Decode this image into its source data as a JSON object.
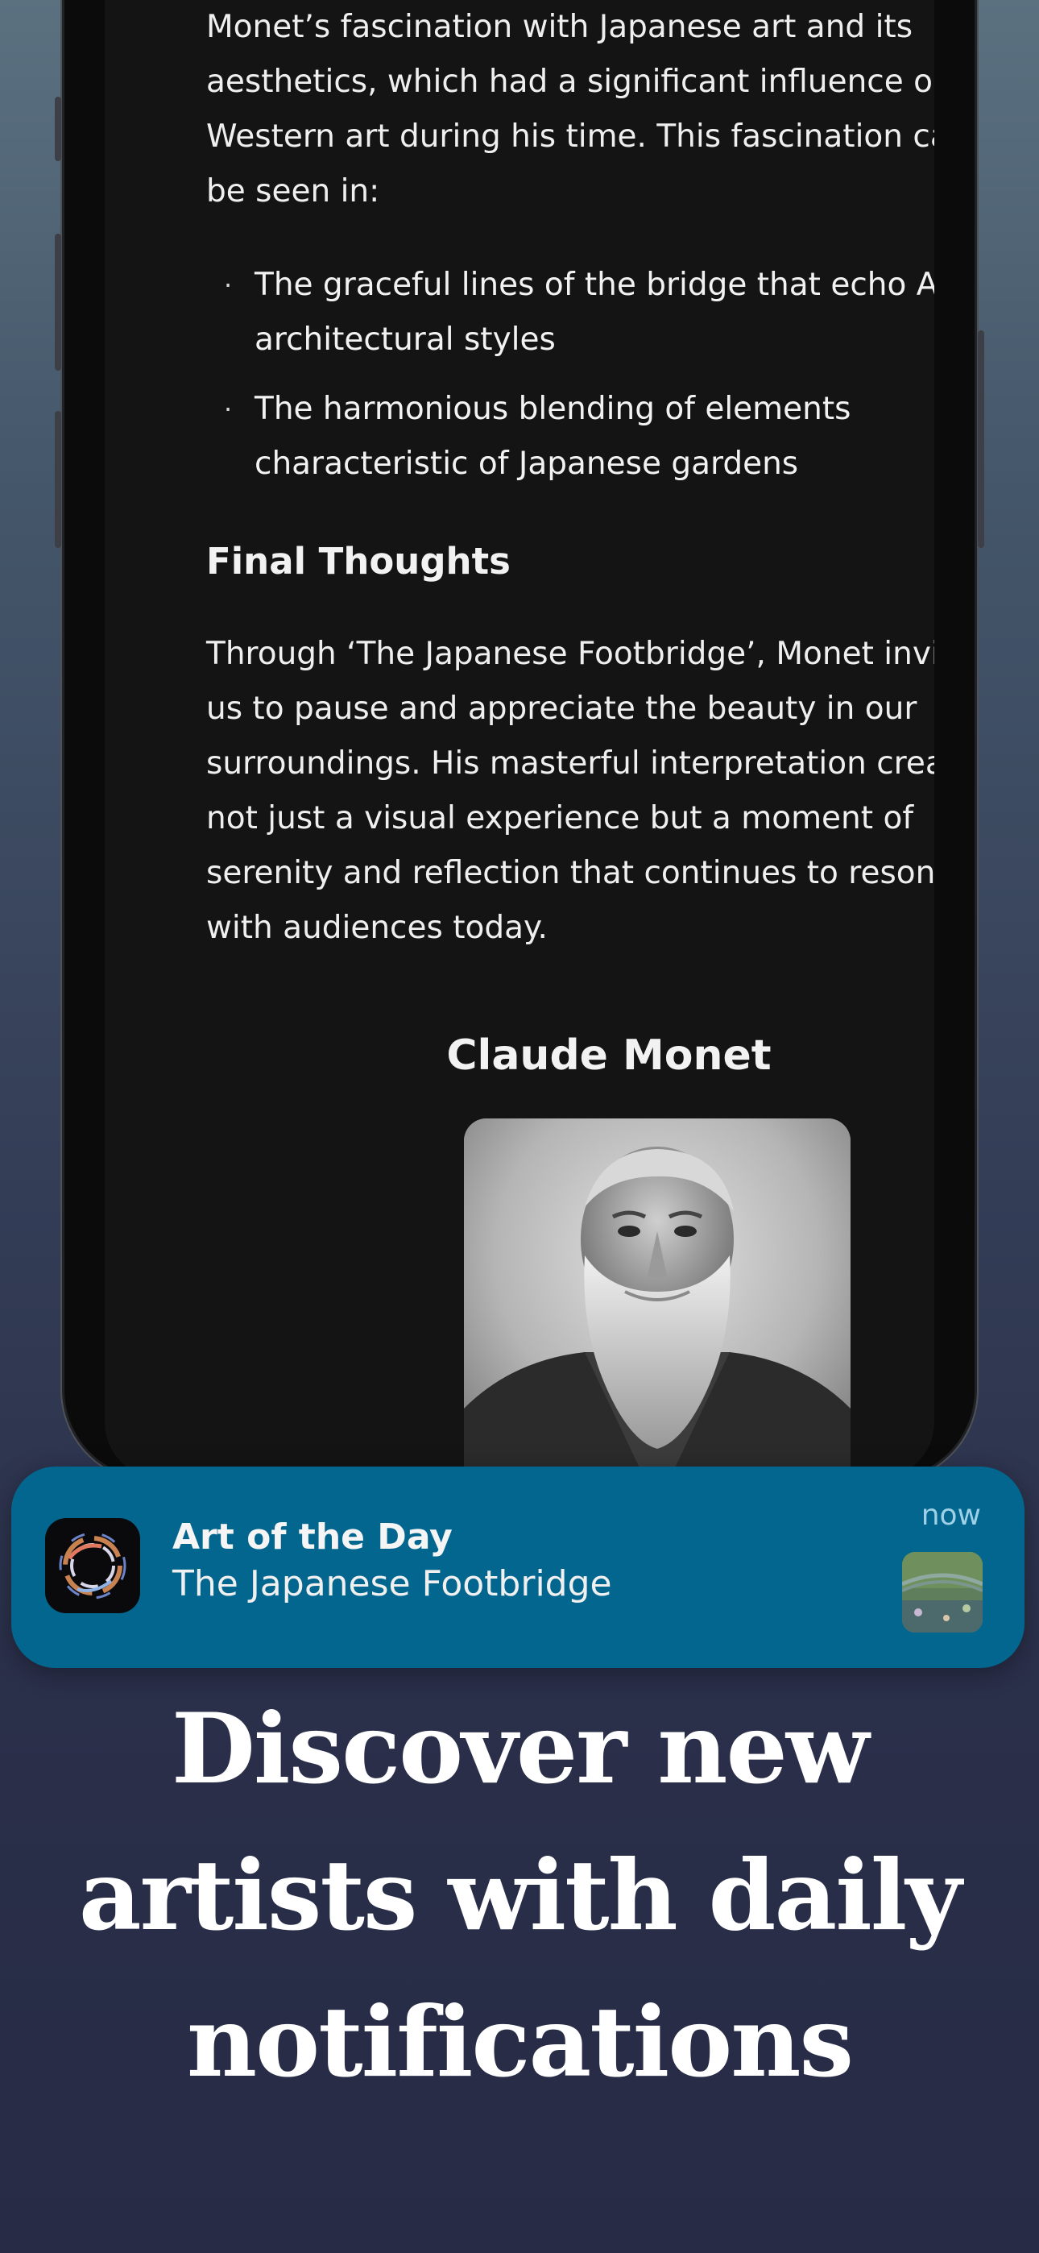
{
  "article": {
    "intro": "Monet’s fascination with Japanese art and its aesthetics, which had a significant influence on Western art during his time. This fascination can be seen in:",
    "bullets": [
      "The graceful lines of the bridge that echo Asian architectural styles",
      "The harmonious blending of elements characteristic of Japanese gardens"
    ],
    "section_heading": "Final Thoughts",
    "closing": "Through ‘The Japanese Footbridge’, Monet invites us to pause and appreciate the beauty in our surroundings. His masterful interpretation creates not just a visual experience but a moment of serenity and reflection that continues to resonate with audiences today.",
    "artist_heading": "Claude Monet"
  },
  "notification": {
    "app_name": "Art of the Day",
    "message": "The Japanese Footbridge",
    "time": "now",
    "thumbnail_icon": "painting-thumbnail"
  },
  "headline": {
    "lines": [
      "Discover new",
      "artists with daily",
      "notifications"
    ]
  },
  "colors": {
    "notification_bg": "#03668f",
    "screen_bg": "#141415"
  }
}
